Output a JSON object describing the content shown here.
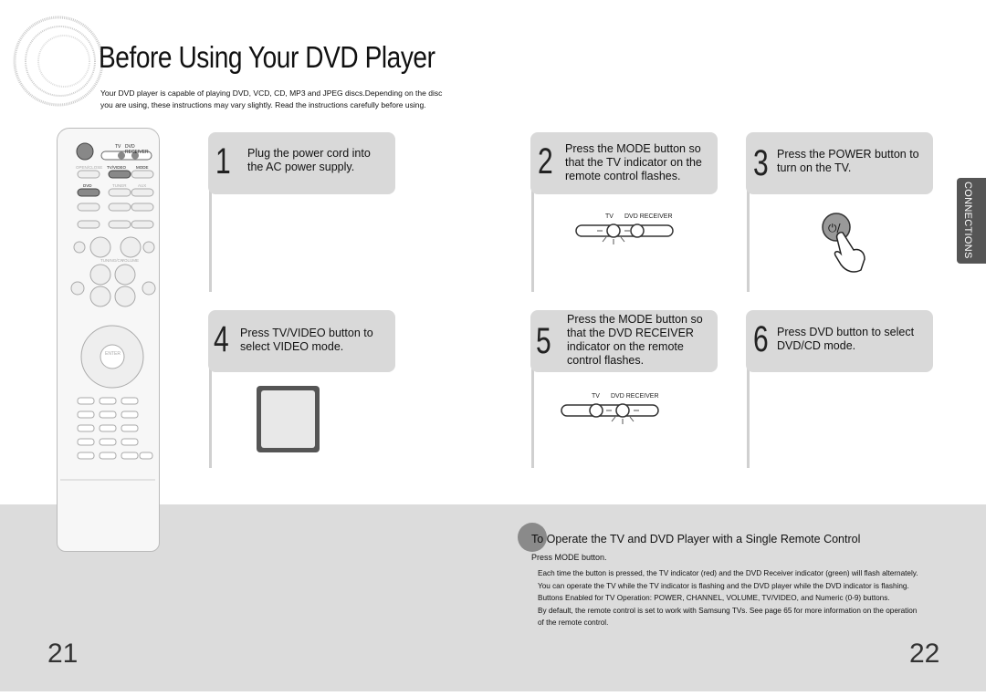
{
  "header": {
    "title": "Before Using Your DVD Player",
    "intro": "Your DVD player is capable of playing DVD, VCD, CD, MP3 and JPEG discs.Depending on the disc you are using, these instructions may vary slightly. Read the instructions carefully before using."
  },
  "side_tab": "CONNECTIONS",
  "steps": [
    {
      "num": "1",
      "text": "Plug the power cord into the AC power supply."
    },
    {
      "num": "2",
      "text": "Press the MODE button so that the TV indicator on the remote control flashes."
    },
    {
      "num": "3",
      "text": "Press the POWER button to turn on the TV."
    },
    {
      "num": "4",
      "text": "Press TV/VIDEO button to select VIDEO mode."
    },
    {
      "num": "5",
      "text": "Press the MODE button so that the DVD RECEIVER indicator on the remote control flashes."
    },
    {
      "num": "6",
      "text": "Press DVD button to select DVD/CD mode."
    }
  ],
  "indicator": {
    "tv": "TV",
    "dvd": "DVD RECEIVER"
  },
  "remote": {
    "tv": "TV",
    "dvd_receiver": "DVD RECEIVER",
    "open_close": "OPEN/CLOSE",
    "tv_video": "TV/VIDEO",
    "mode": "MODE",
    "dvd": "DVD",
    "tuner": "TUNER",
    "aux": "AUX",
    "tuning_ch": "TUNING/CH",
    "volume": "VOLUME",
    "enter": "ENTER"
  },
  "operation": {
    "title": "To Operate the TV and DVD Player with a Single Remote Control",
    "press": "Press MODE button.",
    "notes": [
      "Each time the button is pressed, the TV indicator (red) and the DVD Receiver indicator (green) will flash alternately.",
      "You can operate the TV while the TV indicator is flashing and the DVD player while the DVD indicator is flashing.",
      "Buttons Enabled for TV Operation: POWER, CHANNEL, VOLUME, TV/VIDEO, and Numeric (0-9) buttons.",
      "By default, the remote control is set to work with Samsung TVs. See page 65 for more information on the operation of the remote control."
    ]
  },
  "pages": {
    "left": "21",
    "right": "22"
  }
}
